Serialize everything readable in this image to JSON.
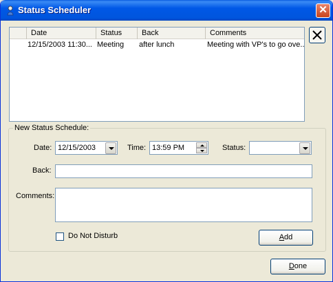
{
  "window": {
    "title": "Status Scheduler",
    "close_glyph": "✕"
  },
  "list": {
    "columns": [
      "",
      "Date",
      "Status",
      "Back",
      "Comments"
    ],
    "rows": [
      {
        "date": "12/15/2003 11:30...",
        "status": "Meeting",
        "back": "after lunch",
        "comments": "Meeting with VP's to go ove..."
      }
    ]
  },
  "delete_icon": "close-x-icon",
  "group": {
    "legend": "New Status Schedule:",
    "date_label": "Date:",
    "date_value": "12/15/2003",
    "time_label": "Time:",
    "time_value": "13:59 PM",
    "status_label": "Status:",
    "status_value": "",
    "back_label": "Back:",
    "back_value": "",
    "comments_label": "Comments:",
    "comments_value": "",
    "dnd_label": "Do Not Disturb",
    "dnd_checked": false,
    "add_label_rest": "dd",
    "add_label_key": "A"
  },
  "footer": {
    "done_label_key": "D",
    "done_label_rest": "one"
  }
}
